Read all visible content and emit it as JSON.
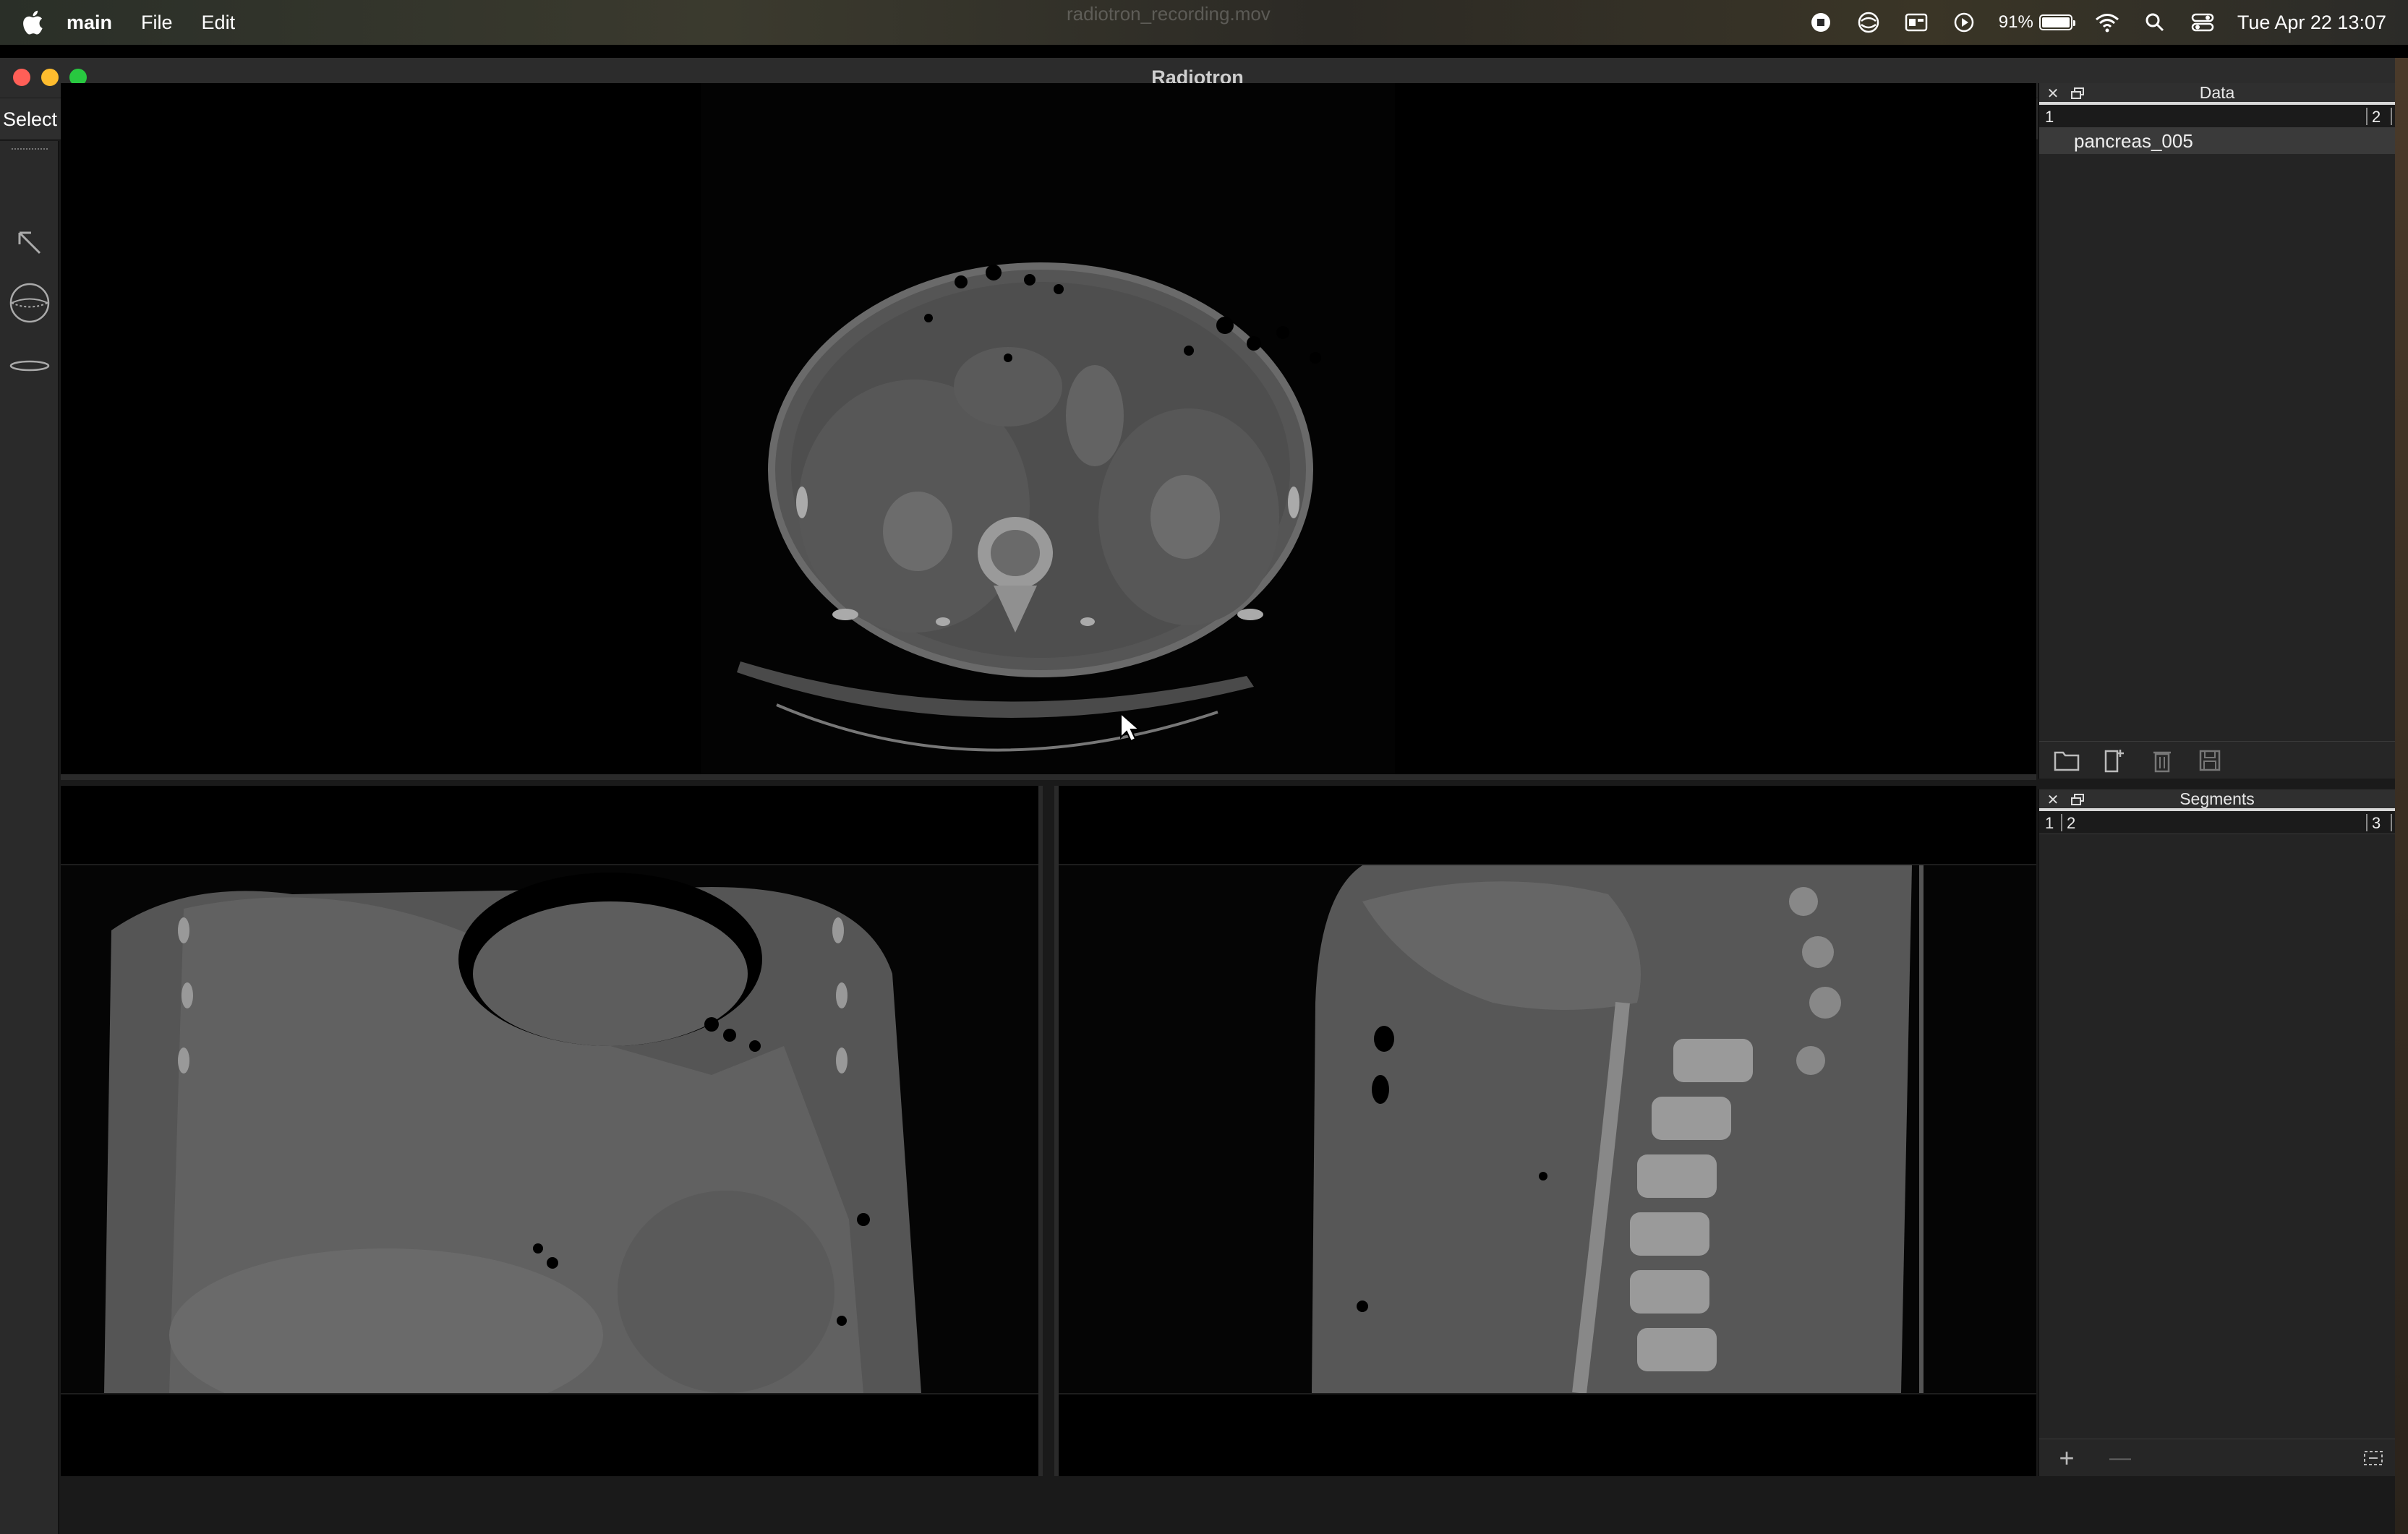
{
  "menubar": {
    "app_name": "main",
    "menus": [
      "File",
      "Edit"
    ],
    "ghost_title": "radiotron_recording.mov",
    "battery_percent": "91%",
    "battery_level": 0.91,
    "datetime": "Tue Apr 22  13:07",
    "icons": [
      "stop-recording-icon",
      "vpn-icon",
      "menu-extra-icon",
      "play-icon",
      "battery-icon",
      "wifi-icon",
      "spotlight-search-icon",
      "control-center-icon"
    ]
  },
  "window": {
    "title": "Radiotron"
  },
  "toolbar": {
    "mode_label": "Select"
  },
  "tools": [
    "select-arrow-icon",
    "sphere-brush-icon",
    "ellipse-tool-icon"
  ],
  "data_panel": {
    "title": "Data",
    "columns": [
      "1",
      "2"
    ],
    "items": [
      "pancreas_005"
    ],
    "footer_icons": [
      "open-folder-icon",
      "new-file-icon",
      "trash-icon",
      "save-icon"
    ]
  },
  "segments_panel": {
    "title": "Segments",
    "columns": [
      "1",
      "2",
      "3"
    ],
    "footer_add": "+",
    "footer_remove": "—"
  },
  "colors": {
    "accent_header_line": "#d8d8d8",
    "close_red": "#ff5f57",
    "minimize_yellow": "#febc2e",
    "zoom_green": "#28c840"
  }
}
